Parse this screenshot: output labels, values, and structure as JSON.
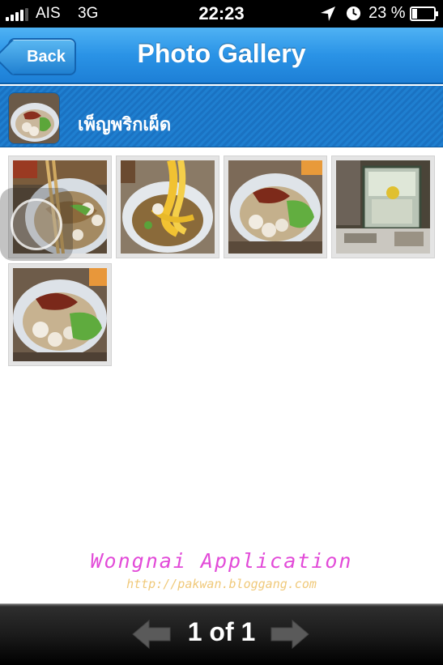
{
  "status_bar": {
    "carrier": "AIS",
    "network": "3G",
    "time": "22:23",
    "battery_percent": "23 %",
    "battery_level": 0.23,
    "signal_bars": 4,
    "icons": [
      "location-icon",
      "alarm-icon",
      "battery-icon"
    ]
  },
  "nav": {
    "back_label": "Back",
    "title": "Photo Gallery"
  },
  "restaurant": {
    "name": "เพ็ญพริกเผ็ด"
  },
  "photos": [
    {
      "name": "photo-1"
    },
    {
      "name": "photo-2"
    },
    {
      "name": "photo-3"
    },
    {
      "name": "photo-4"
    },
    {
      "name": "photo-5"
    }
  ],
  "watermark": {
    "title": "Wongnai Application",
    "url": "http://pakwan.bloggang.com"
  },
  "toolbar": {
    "page_indicator": "1 of 1"
  },
  "colors": {
    "nav_blue": "#2a93e6",
    "header_blue": "#1a72c2",
    "watermark_pink": "#e24ad8",
    "watermark_gold": "#f0c97a"
  }
}
